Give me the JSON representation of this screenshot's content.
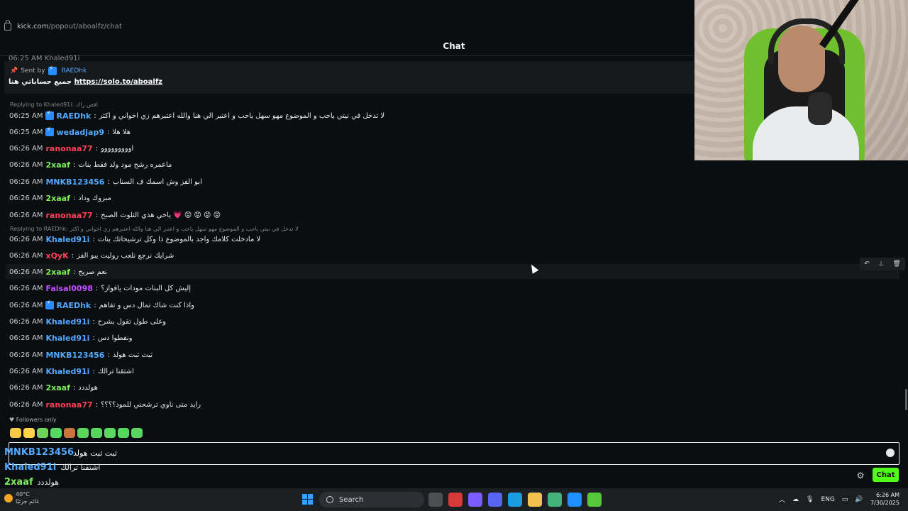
{
  "browser": {
    "url_host": "kick.com",
    "url_path": "/popout/aboalfz/chat"
  },
  "header": {
    "title": "Chat"
  },
  "partial_line": "06:25 AM Khaled91i",
  "pinned": {
    "sent_by_label": "Sent by",
    "sent_by_user": "RAEDhk",
    "text": "جميع حساباتي هنا",
    "link": "https://solo.to/aboalfz"
  },
  "messages": [
    {
      "reply": "Replying to Khaled91i: اقص راك",
      "time": "06:25 AM",
      "user": "RAEDhk",
      "color": "#53a9ff",
      "badge": true,
      "text": "لا تدخل في نيتي ياحب و الموضوع مهو سهل ياحب و اعتبر الي هنا والله اعتبرهم زي اخواني و اكثر"
    },
    {
      "time": "06:25 AM",
      "user": "wedadjap9",
      "color": "#53a9ff",
      "badge": true,
      "text": "هلا هلا"
    },
    {
      "time": "06:26 AM",
      "user": "ranonaa77",
      "color": "#ff4058",
      "badge": false,
      "text": "اووووووووو"
    },
    {
      "time": "06:26 AM",
      "user": "2xaaf",
      "color": "#7df05a",
      "badge": false,
      "text": "ماعمره رشح مود ولد فقط بنات"
    },
    {
      "time": "06:26 AM",
      "user": "MNKB123456",
      "color": "#53a9ff",
      "badge": false,
      "text": "ابو الفز وش اسمك ف السناب"
    },
    {
      "time": "06:26 AM",
      "user": "2xaaf",
      "color": "#7df05a",
      "badge": false,
      "text": "مبروك وداد"
    },
    {
      "time": "06:26 AM",
      "user": "ranonaa77",
      "color": "#ff4058",
      "badge": false,
      "text": "ياخي هذي الثلوث الصبح 💗 😡 😡 😡 😡"
    },
    {
      "reply": "Replying to RAEDhk: لا تدخل في نيتي ياحب و الموضوع مهو سهل ياحب و اعتبر الي هنا والله اعتبرهم زي اخواني و اكثر",
      "time": "06:26 AM",
      "user": "Khaled91i",
      "color": "#53a9ff",
      "badge": false,
      "text": "لا مادخلت كلامك واجد بالموضوع ذا وكل ترشيحاتك بنات"
    },
    {
      "time": "06:26 AM",
      "user": "xQyK",
      "color": "#ff4058",
      "badge": false,
      "text": "شرايك نرجع نلعب روليت يبو الفز"
    },
    {
      "time": "06:26 AM",
      "user": "2xaaf",
      "color": "#7df05a",
      "badge": false,
      "text": "نعم صريح"
    },
    {
      "time": "06:26 AM",
      "user": "Faisal0098",
      "color": "#c64cff",
      "badge": false,
      "text": "إليش كل البنات مودات يافواز؟"
    },
    {
      "time": "06:26 AM",
      "user": "RAEDhk",
      "color": "#53a9ff",
      "badge": true,
      "text": "واذا كنت شاك تمال دس و تفاهم"
    },
    {
      "time": "06:26 AM",
      "user": "Khaled91i",
      "color": "#53a9ff",
      "badge": false,
      "text": "وعلى طول تقول بشرح"
    },
    {
      "time": "06:26 AM",
      "user": "Khaled91i",
      "color": "#53a9ff",
      "badge": false,
      "text": "ونفطوا دس"
    },
    {
      "time": "06:26 AM",
      "user": "MNKB123456",
      "color": "#53a9ff",
      "badge": false,
      "text": "ثبت ثبت هولد"
    },
    {
      "time": "06:26 AM",
      "user": "Khaled91i",
      "color": "#53a9ff",
      "badge": false,
      "text": "اشتقنا ترالك"
    },
    {
      "time": "06:26 AM",
      "user": "2xaaf",
      "color": "#7df05a",
      "badge": false,
      "text": "هولددد"
    },
    {
      "time": "06:26 AM",
      "user": "ranonaa77",
      "color": "#ff4058",
      "badge": false,
      "text": "رايد متى ناوي ترشحني للمود؟؟؟؟"
    }
  ],
  "actions": {
    "reply": "↶",
    "pin": "⊥",
    "delete": "🗑"
  },
  "followers_only": "♥ Followers only",
  "emote_colors": [
    "#f7c948",
    "#ffd34d",
    "#6fd35a",
    "#55d860",
    "#c9733d",
    "#5ad65a",
    "#56d85c",
    "#5ad85f",
    "#53d85a",
    "#5ad660"
  ],
  "input": {
    "value": "ثبت ثبت هولد"
  },
  "overlay": [
    {
      "user": "MNKB123456",
      "color": "#53a9ff",
      "text": ""
    },
    {
      "user": "Khaled91i",
      "color": "#53a9ff",
      "text": "اشتقنا ترالك"
    },
    {
      "user": "2xaaf",
      "color": "#7df05a",
      "text": "هولددد"
    },
    {
      "user": "ranonaa77",
      "color": "#ff4058",
      "text": "رايد متى ناوي ترشحني للمود؟؟؟؟"
    }
  ],
  "send_label": "Chat",
  "taskbar": {
    "weather_temp": "40°C",
    "weather_label": "غائم جزئيًا",
    "search_label": "Search",
    "lang": "ENG",
    "time": "6:26 AM",
    "date": "7/30/2025",
    "icon_colors": [
      "#4a4f55",
      "#d83a3a",
      "#7b5cff",
      "#5865f2",
      "#1b9be0",
      "#f2c14e",
      "#44b37a",
      "#1e90ff",
      "#56c93a"
    ]
  }
}
